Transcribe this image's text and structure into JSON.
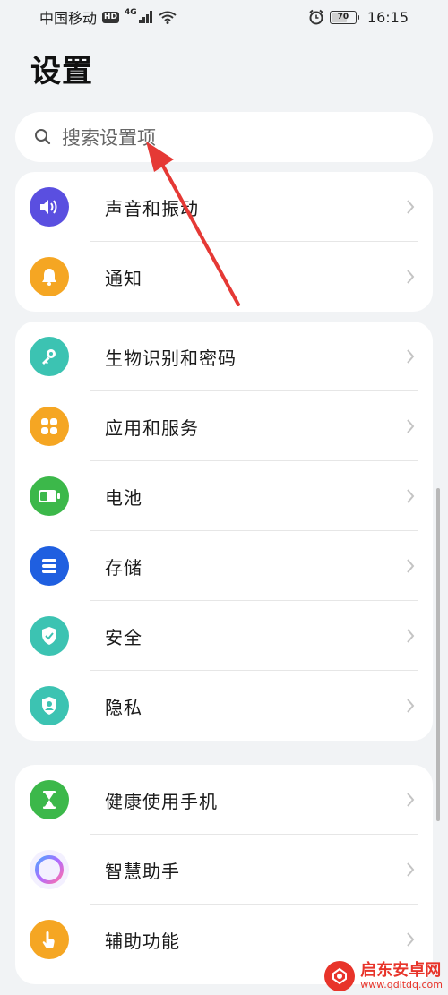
{
  "status_bar": {
    "carrier": "中国移动",
    "hd": "HD",
    "network": "4G",
    "battery": "70",
    "battery_level": 0.7,
    "time": "16:15"
  },
  "page": {
    "title": "设置"
  },
  "search": {
    "placeholder": "搜索设置项"
  },
  "group1": [
    {
      "label": "声音和振动",
      "icon": "volume-icon",
      "color": "#5a4fe0"
    },
    {
      "label": "通知",
      "icon": "bell-icon",
      "color": "#f5a623"
    }
  ],
  "group2": [
    {
      "label": "生物识别和密码",
      "icon": "key-icon",
      "color": "#3cc3b2"
    },
    {
      "label": "应用和服务",
      "icon": "apps-grid-icon",
      "color": "#f5a623"
    },
    {
      "label": "电池",
      "icon": "battery-icon",
      "color": "#3cb84a"
    },
    {
      "label": "存储",
      "icon": "storage-icon",
      "color": "#1f5fe0"
    },
    {
      "label": "安全",
      "icon": "shield-check-icon",
      "color": "#3cc3b2"
    },
    {
      "label": "隐私",
      "icon": "privacy-shield-icon",
      "color": "#3cc3b2"
    }
  ],
  "group3": [
    {
      "label": "健康使用手机",
      "icon": "hourglass-icon",
      "color": "#3cb84a"
    },
    {
      "label": "智慧助手",
      "icon": "assistant-ring-icon",
      "color": "#ffffff"
    },
    {
      "label": "辅助功能",
      "icon": "hand-icon",
      "color": "#f5a623"
    }
  ],
  "annotation": {
    "arrow_color": "#e53935"
  },
  "watermark": {
    "title": "启东安卓网",
    "url": "www.qdltdq.com"
  }
}
